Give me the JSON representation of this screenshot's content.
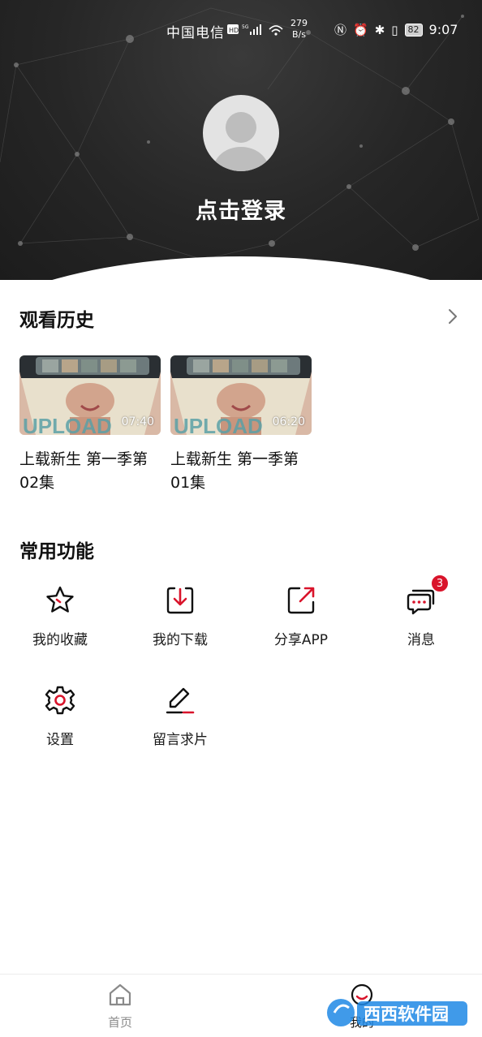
{
  "status_bar": {
    "carrier": "中国电信",
    "network_speed_value": "279",
    "network_speed_unit": "B/s",
    "battery": "82",
    "time": "9:07"
  },
  "profile": {
    "login_text": "点击登录"
  },
  "history": {
    "title": "观看历史",
    "items": [
      {
        "duration": "07:40",
        "title": "上载新生  第一季第02集"
      },
      {
        "duration": "06:20",
        "title": "上载新生 第一季第01集"
      }
    ]
  },
  "functions": {
    "title": "常用功能",
    "items": [
      {
        "label": "我的收藏",
        "icon": "star-icon"
      },
      {
        "label": "我的下载",
        "icon": "download-icon"
      },
      {
        "label": "分享APP",
        "icon": "share-icon"
      },
      {
        "label": "消息",
        "icon": "message-icon",
        "badge": "3"
      },
      {
        "label": "设置",
        "icon": "gear-icon"
      },
      {
        "label": "留言求片",
        "icon": "edit-icon"
      }
    ]
  },
  "bottom_nav": {
    "home_label": "首页",
    "mine_label": "我的"
  },
  "watermark": "西西软件园",
  "accent_color": "#d9142b"
}
